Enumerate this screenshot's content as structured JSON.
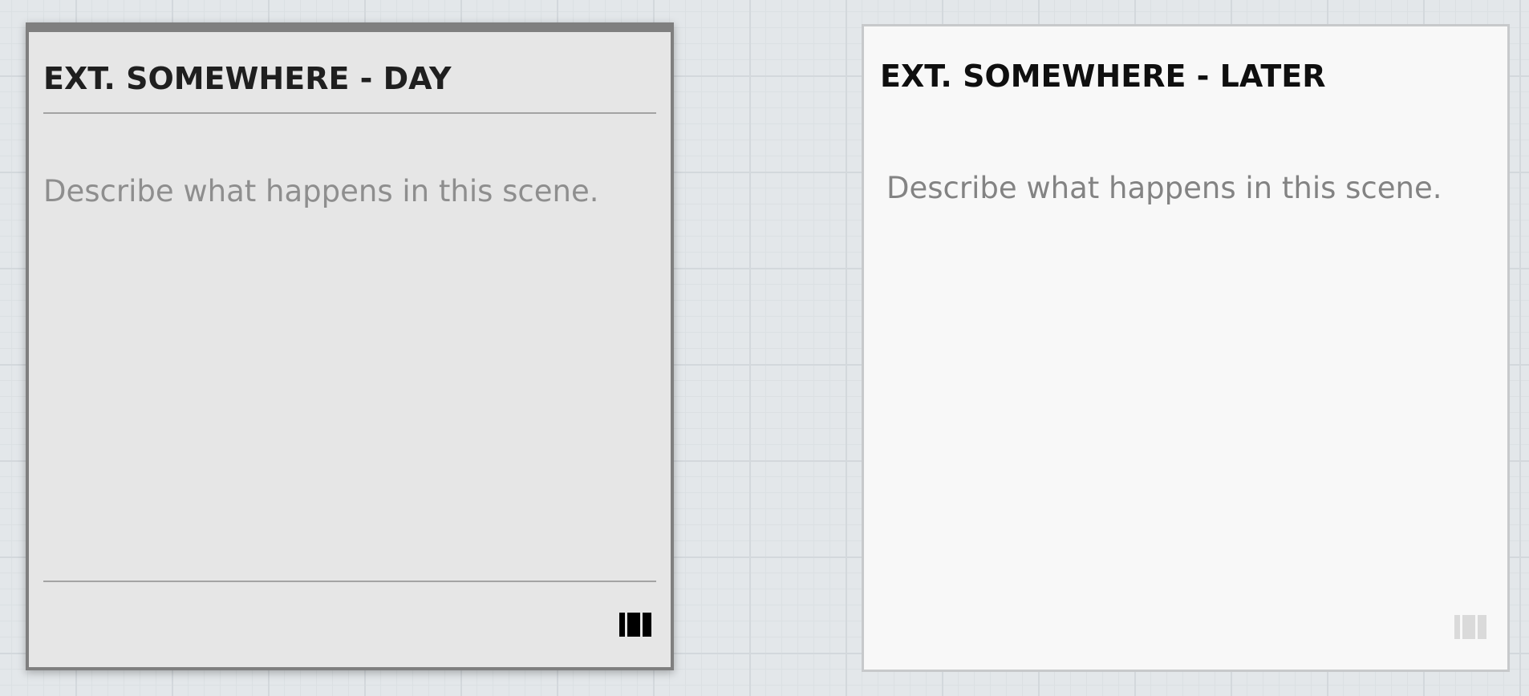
{
  "cards": [
    {
      "title": "EXT. SOMEWHERE - DAY",
      "description_placeholder": "Describe what happens in this scene.",
      "icon": "scene-card-icon",
      "state": "selected"
    },
    {
      "title": "EXT. SOMEWHERE - LATER",
      "description_placeholder": "Describe what happens in this scene.",
      "icon": "scene-card-icon",
      "state": "default"
    }
  ],
  "colors": {
    "canvas_background": "#e3e7ea",
    "grid_major": "#d3d8dc",
    "grid_minor": "#dbe0e3",
    "selected_card_background": "#e6e6e6",
    "selected_card_border": "#7f7f7f",
    "card_background": "#f8f8f8",
    "card_border": "#c7c9cb",
    "title_text": "#1f1f1f",
    "placeholder_text": "#8e8e8e",
    "icon_active": "#000000",
    "icon_faded": "#dadada"
  }
}
